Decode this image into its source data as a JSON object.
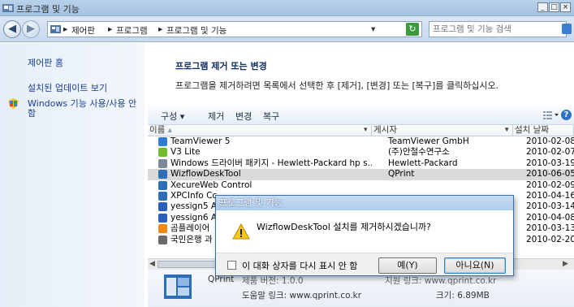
{
  "window": {
    "title": "프로그램 및 기능",
    "buttons": [
      "_",
      "□",
      "×"
    ]
  },
  "address": {
    "crumbs": [
      "제어판",
      "프로그램",
      "프로그램 및 기능"
    ],
    "separator": "▸",
    "search_placeholder": "프로그램 및 기능 검색"
  },
  "sidebar": {
    "items": [
      {
        "label": "제어판 홈"
      },
      {
        "label": "설치된 업데이트 보기"
      },
      {
        "label": "Windows 기능 사용/사용 안",
        "label2": "함"
      }
    ]
  },
  "main": {
    "heading": "프로그램 제거 또는 변경",
    "description": "프로그램을 제거하려면 목록에서 선택한 후 [제거], [변경] 또는 [복구]를 클릭하십시오."
  },
  "toolbar": {
    "organize": "구성 ▾",
    "uninstall": "제거",
    "change": "변경",
    "repair": "복구"
  },
  "table": {
    "columns": [
      "이름",
      "게시자",
      "설치 날짜"
    ],
    "rows": [
      {
        "name": "TeamViewer 5",
        "publisher": "TeamViewer GmbH",
        "date": "2010-02-08",
        "icon": "#2f7bd6"
      },
      {
        "name": "V3 Lite",
        "publisher": "(주)안철수연구소",
        "date": "2010-02-07",
        "icon": "#6fbf2a"
      },
      {
        "name": "Windows 드라이버 패키지 - Hewlett-Packard hp s...",
        "publisher": "Hewlett-Packard",
        "date": "2010-03-19",
        "icon": "#7a8a9a"
      },
      {
        "name": "WizflowDeskTool",
        "publisher": "QPrint",
        "date": "2010-06-05",
        "icon": "#2c6fb8",
        "selected": true
      },
      {
        "name": "XecureWeb Control",
        "publisher": "",
        "date": "2010-02-09",
        "icon": "#2c6fb8"
      },
      {
        "name": "XPCInfo Cc",
        "publisher": "",
        "date": "2010-04-16",
        "icon": "#2c6fb8"
      },
      {
        "name": "yessign5 A",
        "publisher": "",
        "date": "2010-03-14",
        "icon": "#2a5fc0"
      },
      {
        "name": "yessign6 A",
        "publisher": "",
        "date": "2010-04-08",
        "icon": "#2a5fc0"
      },
      {
        "name": "곰플레이어",
        "publisher": "",
        "date": "2010-03-13",
        "icon": "#f08a10"
      },
      {
        "name": "국민은행 과",
        "publisher": "",
        "date": "2010-02-20",
        "icon": "#6a6a6a"
      }
    ]
  },
  "dialog": {
    "title": "프로그램 및 기능",
    "message": "WizflowDeskTool 설치를 제거하시겠습니까?",
    "checkbox_label": "이 대화 상자를 다시 표시 안 함",
    "yes": "예(Y)",
    "no": "아니요(N)"
  },
  "details": {
    "line1_left": "QPrint",
    "line1_mid": "제품 버전: 1.0.0",
    "line1_right": "지원 링크: www.qprint.co.kr",
    "help_link": "도움말 링크: www.qprint.co.kr",
    "size": "크기: 6.89MB"
  },
  "colors": {
    "link": "#1a3f8f",
    "heading": "#0f2f66",
    "selection": "#dadada"
  }
}
